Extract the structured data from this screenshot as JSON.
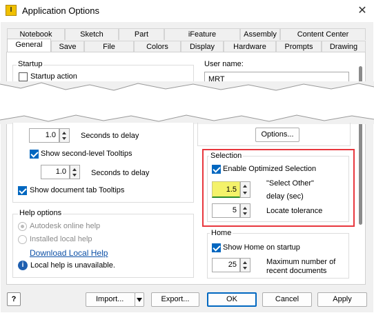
{
  "window": {
    "title": "Application Options",
    "icon_glyph": "I"
  },
  "tabs_row1": [
    "Notebook",
    "Sketch",
    "Part",
    "iFeature",
    "Assembly",
    "Content Center"
  ],
  "tabs_row2": [
    "General",
    "Save",
    "File",
    "Colors",
    "Display",
    "Hardware",
    "Prompts",
    "Drawing"
  ],
  "startup": {
    "title": "Startup",
    "startup_action": "Startup action",
    "user_name_label": "User name:",
    "user_name_value": "MRT"
  },
  "tooltips": {
    "delay1_value": "1.0",
    "delay1_label": "Seconds to delay",
    "second_level": "Show second-level Tooltips",
    "delay2_value": "1.0",
    "delay2_label": "Seconds to delay",
    "doc_tab": "Show document tab Tooltips"
  },
  "options_button": "Options...",
  "help": {
    "title": "Help options",
    "online": "Autodesk online help",
    "local": "Installed local help",
    "download_link": "Download Local Help",
    "unavailable": "Local help is unavailable."
  },
  "selection": {
    "title": "Selection",
    "enable_optimized": "Enable Optimized Selection",
    "select_other_value": "1.5",
    "select_other_label1": "\"Select Other\"",
    "select_other_label2": "delay (sec)",
    "locate_value": "5",
    "locate_label": "Locate tolerance"
  },
  "home": {
    "title": "Home",
    "show_home": "Show Home on startup",
    "max_value": "25",
    "max_label1": "Maximum number of",
    "max_label2": "recent documents"
  },
  "buttons": {
    "import": "Import...",
    "export": "Export...",
    "ok": "OK",
    "cancel": "Cancel",
    "apply": "Apply"
  },
  "colors": {
    "accent": "#0067c0",
    "highlight_box": "#e8363d",
    "select_other_bg": "#f4f26a",
    "link": "#0b4fa6"
  }
}
